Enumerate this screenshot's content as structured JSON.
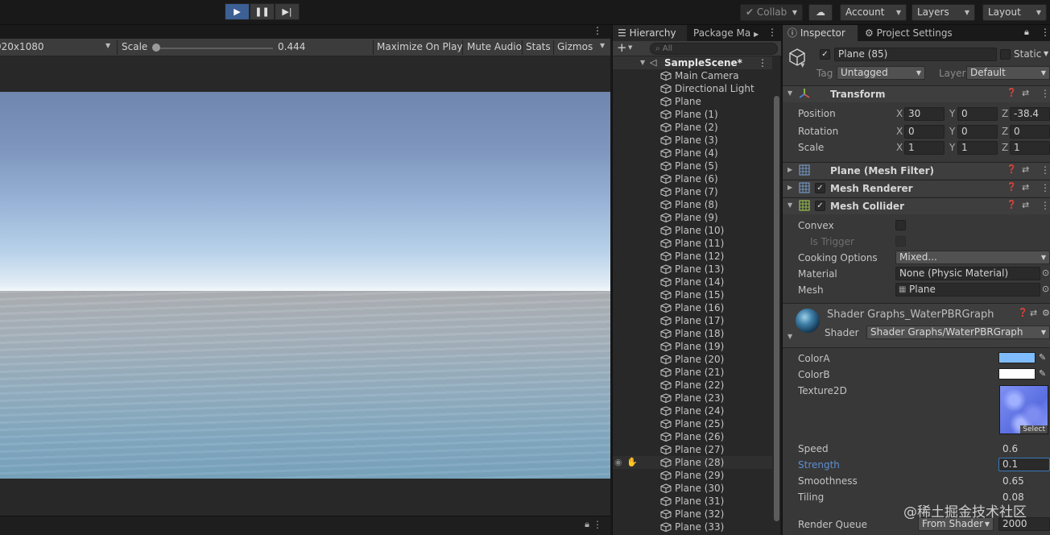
{
  "toolbar": {
    "collab_label": "Collab",
    "account_label": "Account",
    "layers_label": "Layers",
    "layout_label": "Layout"
  },
  "game_view": {
    "resolution": "920x1080",
    "scale_label": "Scale",
    "scale_value": "0.444",
    "buttons": [
      "Maximize On Play",
      "Mute Audio",
      "Stats",
      "Gizmos"
    ]
  },
  "hierarchy": {
    "tab_hierarchy": "Hierarchy",
    "tab_package": "Package Ma",
    "search_placeholder": "All",
    "scene_name": "SampleScene*",
    "items": [
      "Main Camera",
      "Directional Light",
      "Plane",
      "Plane (1)",
      "Plane (2)",
      "Plane (3)",
      "Plane (4)",
      "Plane (5)",
      "Plane (6)",
      "Plane (7)",
      "Plane (8)",
      "Plane (9)",
      "Plane (10)",
      "Plane (11)",
      "Plane (12)",
      "Plane (13)",
      "Plane (14)",
      "Plane (15)",
      "Plane (16)",
      "Plane (17)",
      "Plane (18)",
      "Plane (19)",
      "Plane (20)",
      "Plane (21)",
      "Plane (22)",
      "Plane (23)",
      "Plane (24)",
      "Plane (25)",
      "Plane (26)",
      "Plane (27)",
      "Plane (28)",
      "Plane (29)",
      "Plane (30)",
      "Plane (31)",
      "Plane (32)",
      "Plane (33)"
    ],
    "highlighted_item": "Plane (28)"
  },
  "inspector": {
    "tab_inspector": "Inspector",
    "tab_project_settings": "Project Settings",
    "object_name": "Plane (85)",
    "static_label": "Static",
    "tag_label": "Tag",
    "tag_value": "Untagged",
    "layer_label": "Layer",
    "layer_value": "Default",
    "transform": {
      "title": "Transform",
      "position_label": "Position",
      "rotation_label": "Rotation",
      "scale_label": "Scale",
      "position": {
        "x": "30",
        "y": "0",
        "z": "-38.4"
      },
      "rotation": {
        "x": "0",
        "y": "0",
        "z": "0"
      },
      "scale": {
        "x": "1",
        "y": "1",
        "z": "1"
      }
    },
    "mesh_filter_title": "Plane (Mesh Filter)",
    "mesh_renderer_title": "Mesh Renderer",
    "mesh_collider": {
      "title": "Mesh Collider",
      "convex_label": "Convex",
      "is_trigger_label": "Is Trigger",
      "cooking_label": "Cooking Options",
      "cooking_value": "Mixed...",
      "material_label": "Material",
      "material_value": "None (Physic Material)",
      "mesh_label": "Mesh",
      "mesh_value": "Plane"
    },
    "material": {
      "title": "Shader Graphs_WaterPBRGraph",
      "shader_label": "Shader",
      "shader_value": "Shader Graphs/WaterPBRGraph",
      "colorA_label": "ColorA",
      "colorA": "#7fbcff",
      "colorB_label": "ColorB",
      "colorB": "#ffffff",
      "texture_label": "Texture2D",
      "texture_select": "Select",
      "speed_label": "Speed",
      "speed_value": "0.6",
      "strength_label": "Strength",
      "strength_value": "0.1",
      "smoothness_label": "Smoothness",
      "smoothness_value": "0.65",
      "tiling_label": "Tiling",
      "tiling_value": "0.08",
      "render_queue_label": "Render Queue",
      "render_queue_mode": "From Shader",
      "render_queue_value": "2000"
    }
  },
  "watermark": "@稀土掘金技术社区"
}
